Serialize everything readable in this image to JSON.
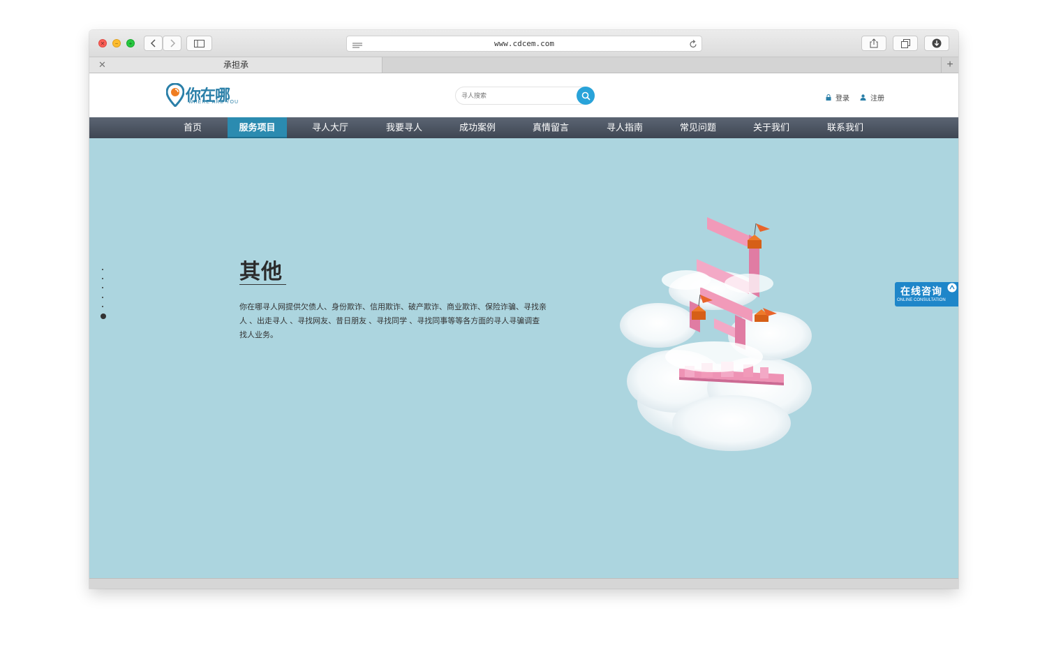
{
  "browser": {
    "url": "www.cdcem.com",
    "tab_title": "承担承"
  },
  "site": {
    "logo_cn": "你在哪",
    "logo_en": "WHERE ARE YOU",
    "search_placeholder": "寻人搜索",
    "login_label": "登录",
    "register_label": "注册"
  },
  "nav": {
    "items": [
      {
        "label": "首页"
      },
      {
        "label": "服务项目"
      },
      {
        "label": "寻人大厅"
      },
      {
        "label": "我要寻人"
      },
      {
        "label": "成功案例"
      },
      {
        "label": "真情留言"
      },
      {
        "label": "寻人指南"
      },
      {
        "label": "常见问题"
      },
      {
        "label": "关于我们"
      },
      {
        "label": "联系我们"
      }
    ],
    "active_index": 1
  },
  "hero": {
    "title": "其他",
    "description": "你在哪寻人网提供欠债人、身份欺诈、信用欺诈、破产欺诈、商业欺诈、保险诈骗、寻找亲人 、出走寻人 、寻找网友、昔日朋友 、寻找同学 、寻找同事等等各方面的寻人寻骗调查找人业务。",
    "slide_count": 6,
    "active_slide": 6,
    "background_color": "#acd5df"
  },
  "consult": {
    "label_cn": "在线咨询",
    "label_en": "ONLINE CONSULTATION"
  }
}
